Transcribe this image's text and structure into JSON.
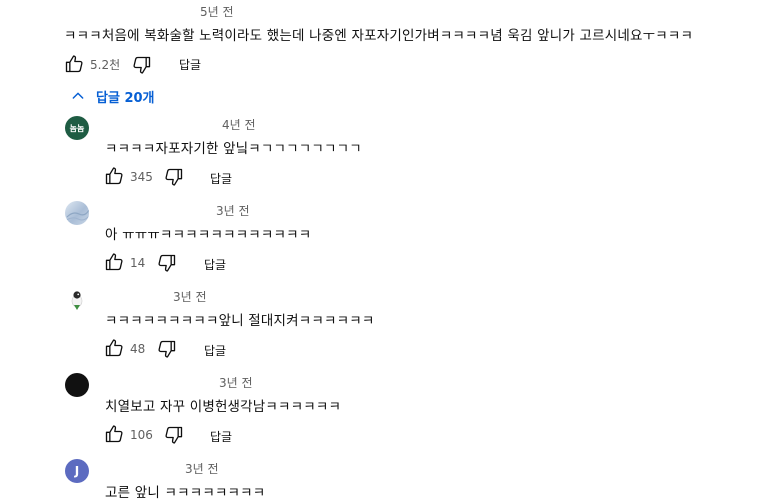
{
  "top_comment": {
    "timestamp": "5년 전",
    "text": "ㅋㅋㅋ처음에 복화술할 노력이라도 했는데 나중엔 자포자기인가벼ㅋㅋㅋㅋ념 욱김 앞니가 고르시네요ㅜㅋㅋㅋ",
    "likes": "5.2천",
    "reply_label": "답글"
  },
  "replies_toggle": {
    "label": "답글 20개",
    "icon": "chevron-up-icon"
  },
  "replies": [
    {
      "avatar_label": "놈놈",
      "avatar_color": "#1e5c43",
      "timestamp": "4년 전",
      "text": "ㅋㅋㅋㅋ자포자기한 앞닠ㅋㄱㄱㄱㄱㄱㄱㄱㄱ",
      "likes": "345",
      "reply_label": "답글"
    },
    {
      "avatar_label": "",
      "avatar_color": "#b8c8dc",
      "timestamp": "3년 전",
      "text": "아 ㅠㅠㅠㅋㅋㅋㅋㅋㅋㅋㅋㅋㅋㅋㅋ",
      "likes": "14",
      "reply_label": "답글"
    },
    {
      "avatar_label": "",
      "avatar_color": "#ffffff",
      "timestamp": "3년 전",
      "text": "ㅋㅋㅋㅋㅋㅋㅋㅋㅋ앞니 절대지켜ㅋㅋㅋㅋㅋㅋ",
      "likes": "48",
      "reply_label": "답글"
    },
    {
      "avatar_label": "",
      "avatar_color": "#111111",
      "timestamp": "3년 전",
      "text": "치열보고 자꾸 이병헌생각남ㅋㅋㅋㅋㅋㅋ",
      "likes": "106",
      "reply_label": "답글"
    },
    {
      "avatar_label": "J",
      "avatar_color": "#5c6bc0",
      "timestamp": "3년 전",
      "text": "고른 앞니 ㅋㅋㅋㅋㅋㅋㅋㅋ"
    }
  ]
}
